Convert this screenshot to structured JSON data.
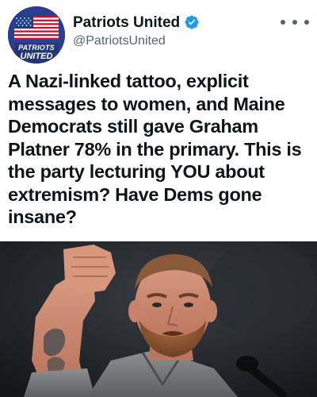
{
  "account": {
    "display_name": "Patriots United",
    "handle": "@PatriotsUnited",
    "verified": true,
    "avatar": {
      "line1": "PATRIOTS",
      "line2": "UNITED",
      "icon": "us-flag"
    }
  },
  "menu": {
    "icon": "more-horizontal-icon"
  },
  "tweet": {
    "text": "A Nazi-linked tattoo, explicit messages to women, and Maine Democrats still gave Graham Platner 78% in the primary. This is the party lecturing YOU about extremism? Have Dems gone insane?"
  },
  "media": {
    "type": "photo",
    "subject": "man-raising-fist-at-microphone"
  },
  "colors": {
    "text": "#0f1419",
    "secondary": "#536471",
    "verified_badge": "#1d9bf0"
  }
}
